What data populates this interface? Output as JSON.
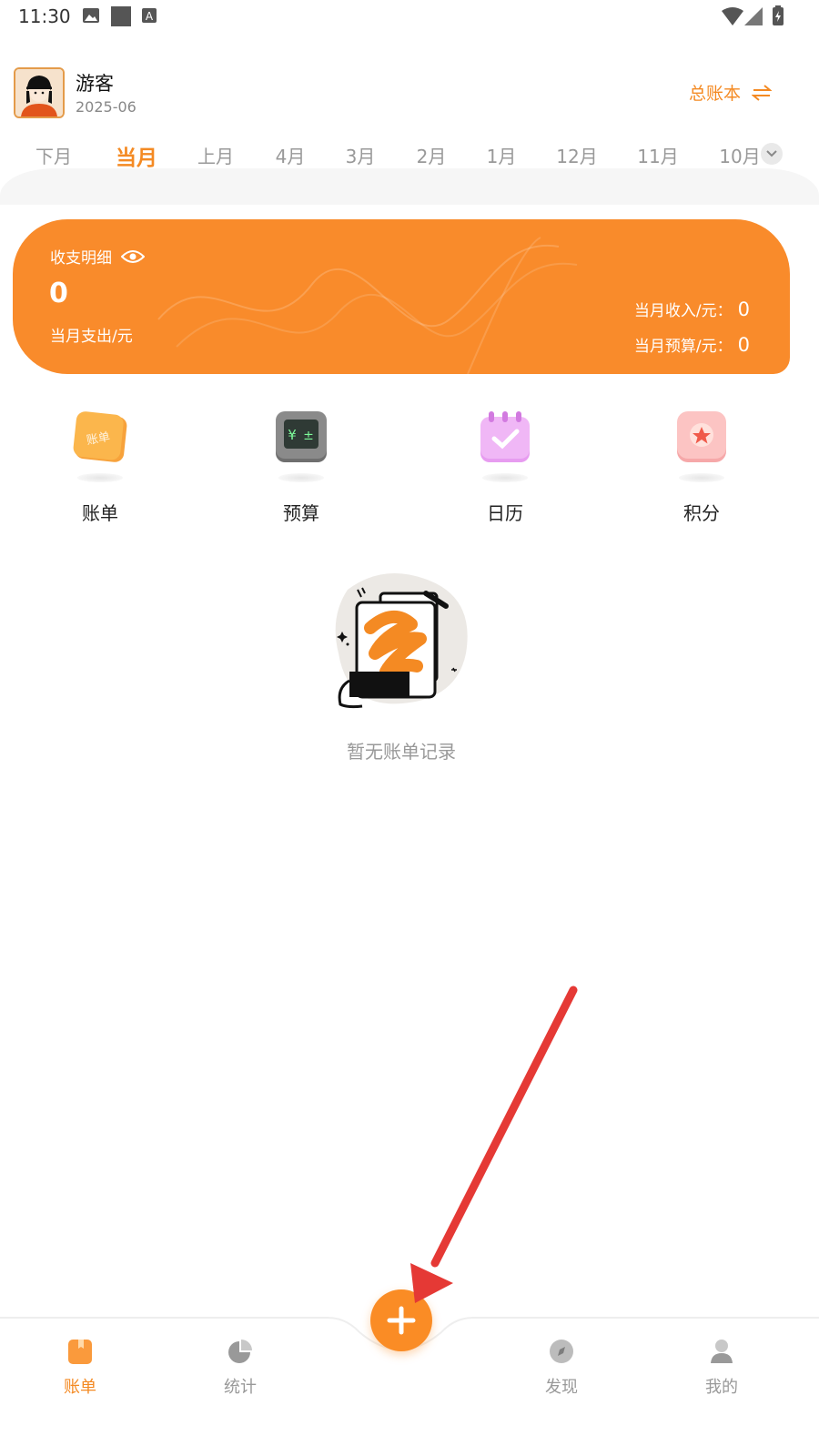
{
  "status_bar": {
    "time": "11:30",
    "icons": [
      "image-icon",
      "square-icon",
      "a-icon",
      "wifi-icon",
      "signal-icon",
      "battery-icon"
    ]
  },
  "header": {
    "username": "游客",
    "period": "2025-06",
    "ledger_switch_label": "总账本",
    "switch_icon": "swap-icon"
  },
  "month_tabs": {
    "items": [
      "下月",
      "当月",
      "上月",
      "4月",
      "3月",
      "2月",
      "1月",
      "12月",
      "11月",
      "10月"
    ],
    "active": "当月",
    "more_icon": "chevron-down-icon"
  },
  "summary": {
    "title": "收支明细",
    "eye_icon": "eye-icon",
    "expense_value": "0",
    "expense_label": "当月支出/元",
    "income_label": "当月收入/元：",
    "income_value": "0",
    "budget_label": "当月预算/元：",
    "budget_value": "0"
  },
  "quick_actions": [
    {
      "label": "账单",
      "icon": "bill-icon",
      "icon_text": "账单"
    },
    {
      "label": "预算",
      "icon": "calculator-icon"
    },
    {
      "label": "日历",
      "icon": "calendar-icon"
    },
    {
      "label": "积分",
      "icon": "points-icon"
    }
  ],
  "empty_state": {
    "text": "暂无账单记录",
    "icon": "empty-bill-illustration"
  },
  "bottom_nav": {
    "items": [
      "账单",
      "统计",
      "发现",
      "我的"
    ],
    "active": "账单",
    "add_icon": "plus-icon"
  },
  "colors": {
    "accent": "#f48a23",
    "card": "#f98b2b",
    "annotation": "#e53935"
  }
}
